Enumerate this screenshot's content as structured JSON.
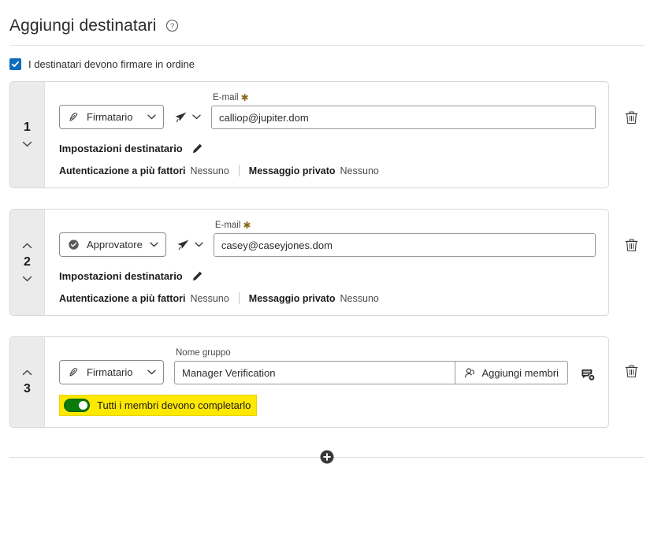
{
  "header": {
    "title": "Aggiungi destinatari",
    "help_icon": "help-circle-icon"
  },
  "order_option": {
    "checked": true,
    "label": "I destinatari devono firmare in ordine"
  },
  "recipients": [
    {
      "index": "1",
      "role": "Firmatario",
      "role_icon": "signature-pen-icon",
      "delivery_icon": "paper-plane-icon",
      "field_label": "E-mail",
      "field_required": "✱",
      "value": "calliop@jupiter.dom",
      "placeholder": "",
      "settings_title": "Impostazioni destinatario",
      "edit_icon": "pencil-icon",
      "meta": [
        {
          "key": "Autenticazione a più fattori",
          "value": "Nessuno"
        },
        {
          "key": "Messaggio privato",
          "value": "Nessuno"
        }
      ],
      "delete_icon": "trash-icon",
      "can_move_up": false,
      "can_move_down": true
    },
    {
      "index": "2",
      "role": "Approvatore",
      "role_icon": "check-circle-icon",
      "delivery_icon": "paper-plane-icon",
      "field_label": "E-mail",
      "field_required": "✱",
      "value": "casey@caseyjones.dom",
      "placeholder": "",
      "settings_title": "Impostazioni destinatario",
      "edit_icon": "pencil-icon",
      "meta": [
        {
          "key": "Autenticazione a più fattori",
          "value": "Nessuno"
        },
        {
          "key": "Messaggio privato",
          "value": "Nessuno"
        }
      ],
      "delete_icon": "trash-icon",
      "can_move_up": true,
      "can_move_down": true
    }
  ],
  "group_recipient": {
    "index": "3",
    "role": "Firmatario",
    "role_icon": "signature-pen-icon",
    "field_label": "Nome gruppo",
    "value": "Manager Verification",
    "placeholder": "",
    "add_members_label": "Aggiungi membri",
    "add_members_icon": "add-person-icon",
    "group_settings_icon": "group-message-settings-icon",
    "toggle": {
      "on": true,
      "label": "Tutti i membri devono completarlo",
      "highlight_color": "#ffe800",
      "on_color": "#0a7a0a"
    },
    "delete_icon": "trash-icon",
    "can_move_up": true,
    "can_move_down": false
  },
  "footer": {
    "add_icon": "plus-circle-icon"
  },
  "colors": {
    "checkbox_blue": "#0f6cbd",
    "rail_gray": "#ebebeb",
    "border_gray": "#d8d8d8",
    "highlight_yellow": "#ffe800",
    "toggle_green": "#0a7a0a"
  }
}
